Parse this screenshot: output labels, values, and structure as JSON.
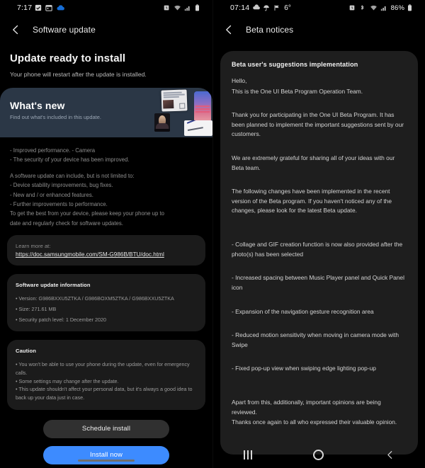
{
  "left": {
    "status": {
      "time": "7:17",
      "icons_left": [
        "checkbox-icon",
        "calendar-icon",
        "cloud-icon"
      ],
      "icons_right": [
        "alarm-icon",
        "wifi-icon",
        "signal-icon",
        "battery-icon"
      ]
    },
    "appbar": {
      "back_icon": "back-chevron-icon",
      "title": "Software update"
    },
    "heading": "Update ready to install",
    "subheading": "Your phone will restart after the update is installed.",
    "whats_new": {
      "title": "What's new",
      "desc": "Find out what's included in this update."
    },
    "changelog": [
      "- Improved performance. - Camera",
      "- The security of your device has been improved."
    ],
    "changelog2": [
      "A software update can include, but is not limited to:",
      "  - Device stability improvements, bug fixes.",
      "  - New and / or enhanced features.",
      "  - Further improvements to performance.",
      "To get the best from your device, please keep your phone up to",
      "date and regularly check for software updates."
    ],
    "learn_more": {
      "label": "Learn more at:",
      "url": "https://doc.samsungmobile.com/SM-G986B/BTU/doc.html"
    },
    "update_info": {
      "title": "Software update information",
      "lines": [
        "• Version: G986BXXU5ZTKA / G986BOXM5ZTKA / G986BXXU5ZTKA",
        "• Size: 271.61 MB",
        "• Security patch level: 1 December 2020"
      ]
    },
    "caution": {
      "title": "Caution",
      "lines": [
        "• You won't be able to use your phone during the update, even for emergency",
        "   calls.",
        "• Some settings may change after the update.",
        "• This update shouldn't affect your personal data, but it's always a good idea to",
        "   back up your data just in case."
      ]
    },
    "buttons": {
      "schedule": "Schedule install",
      "install": "Install now",
      "install_color": "#3d8bff"
    }
  },
  "right": {
    "status": {
      "time": "07:14",
      "temperature": "6°",
      "battery": "86%",
      "icons_left": [
        "cloud-icon",
        "umbrella-icon",
        "flag-icon"
      ],
      "icons_right": [
        "alarm-icon",
        "bluetooth-icon",
        "wifi-icon",
        "signal-icon",
        "battery-icon"
      ]
    },
    "appbar": {
      "back_icon": "back-chevron-icon",
      "title": "Beta notices"
    },
    "notice_title": "Beta user's suggestions implementation",
    "paragraphs": [
      "Hello,",
      "This is the One UI Beta Program Operation Team.",
      "Thank you for participating in the One UI Beta Program. It has been planned to implement the important suggestions sent by our customers.",
      "We are extremely grateful for sharing all of your ideas with our Beta team.",
      "The following changes have been implemented in the recent version of the Beta program. If you haven't noticed any of the changes, please look for the latest Beta update."
    ],
    "changes": [
      "- Collage and GIF creation function is now also provided after the photo(s) has been selected",
      "- Increased spacing between Music Player panel and Quick Panel icon",
      "- Expansion of the navigation gesture recognition area",
      "- Reduced motion sensitivity when moving in camera mode with Swipe",
      "- Fixed pop-up view when swiping edge lighting pop-up"
    ],
    "closing": [
      "Apart from this, additionally, important opinions are being reviewed.",
      "Thanks once again to all who expressed their valuable opinion."
    ],
    "navbar": {
      "recents": "recents-icon",
      "home": "home-icon",
      "back": "back-icon"
    }
  }
}
